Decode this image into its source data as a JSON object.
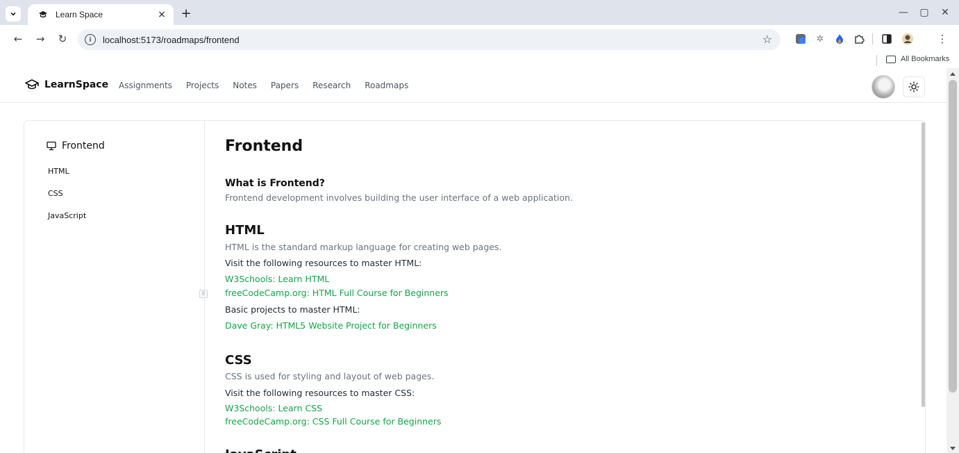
{
  "browser": {
    "tab_title": "Learn Space",
    "tab_close": "×",
    "new_tab": "+",
    "url": "localhost:5173/roadmaps/frontend",
    "bookmarks_label": "All Bookmarks",
    "window_controls": [
      "—",
      "▢",
      "✕"
    ]
  },
  "header": {
    "brand": "LearnSpace",
    "nav": [
      "Assignments",
      "Projects",
      "Notes",
      "Papers",
      "Research",
      "Roadmaps"
    ]
  },
  "sidebar": {
    "title": "Frontend",
    "items": [
      "HTML",
      "CSS",
      "JavaScript"
    ]
  },
  "content": {
    "title": "Frontend",
    "intro_heading": "What is Frontend?",
    "intro_text": "Frontend development involves building the user interface of a web application.",
    "html": {
      "heading": "HTML",
      "description": "HTML is the standard markup language for creating web pages.",
      "resources_label": "Visit the following resources to master HTML:",
      "resources": [
        "W3Schools: Learn HTML",
        "freeCodeCamp.org: HTML Full Course for Beginners"
      ],
      "projects_label": "Basic projects to master HTML:",
      "projects": [
        "Dave Gray: HTML5 Website Project for Beginners"
      ]
    },
    "css": {
      "heading": "CSS",
      "description": "CSS is used for styling and layout of web pages.",
      "resources_label": "Visit the following resources to master CSS:",
      "resources": [
        "W3Schools: Learn CSS",
        "freeCodeCamp.org: CSS Full Course for Beginners"
      ]
    },
    "next_heading": "JavaScript"
  },
  "colors": {
    "link": "#16a34a",
    "tabstrip": "#dfe3eb",
    "omnibox": "#eef1f6"
  }
}
